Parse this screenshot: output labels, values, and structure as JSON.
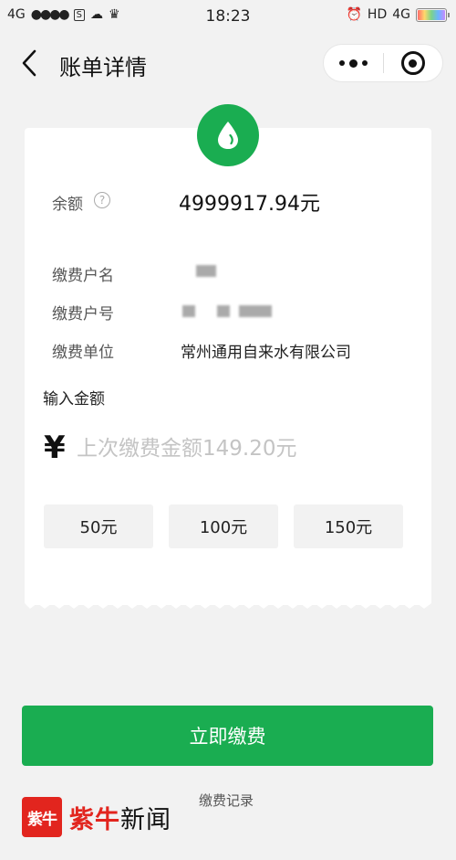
{
  "status_bar": {
    "network": "4G",
    "time": "18:23",
    "hd_label": "HD",
    "network_right": "4G"
  },
  "nav": {
    "title": "账单详情"
  },
  "bill": {
    "balance_label": "余额",
    "help_symbol": "?",
    "balance_value": "4999917.94元",
    "account_name_label": "缴费户名",
    "account_number_label": "缴费户号",
    "company_label": "缴费单位",
    "company_value": "常州通用自来水有限公司"
  },
  "amount": {
    "section_title": "输入金额",
    "currency_symbol": "¥",
    "placeholder": "上次缴费金额149.20元",
    "value": "",
    "quick_options": [
      "50元",
      "100元",
      "150元"
    ]
  },
  "actions": {
    "pay_button": "立即缴费",
    "records_link": "缴费记录"
  },
  "colors": {
    "brand_green": "#1aad51",
    "logo_red": "#e2251e"
  }
}
